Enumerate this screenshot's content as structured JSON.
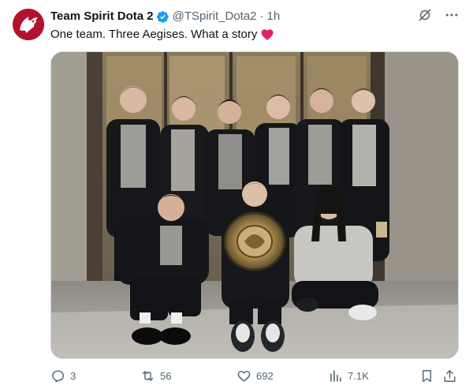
{
  "account": {
    "display_name": "Team Spirit Dota 2",
    "handle": "@TSpirit_Dota2",
    "separator": "·",
    "time": "1h",
    "verified": true,
    "avatar_color": "#b3122e"
  },
  "tweet": {
    "text": "One team. Three Aegises. What a story",
    "emoji": "red-heart",
    "heart_color": "#e0245e"
  },
  "media": {
    "description_icon": "team-photo-image"
  },
  "actions": {
    "replies": "3",
    "retweets": "56",
    "likes": "692",
    "views": "7.1K"
  },
  "colors": {
    "text": "#0f1419",
    "secondary": "#536471",
    "verified": "#1d9bf0",
    "border": "#cfd9de"
  }
}
